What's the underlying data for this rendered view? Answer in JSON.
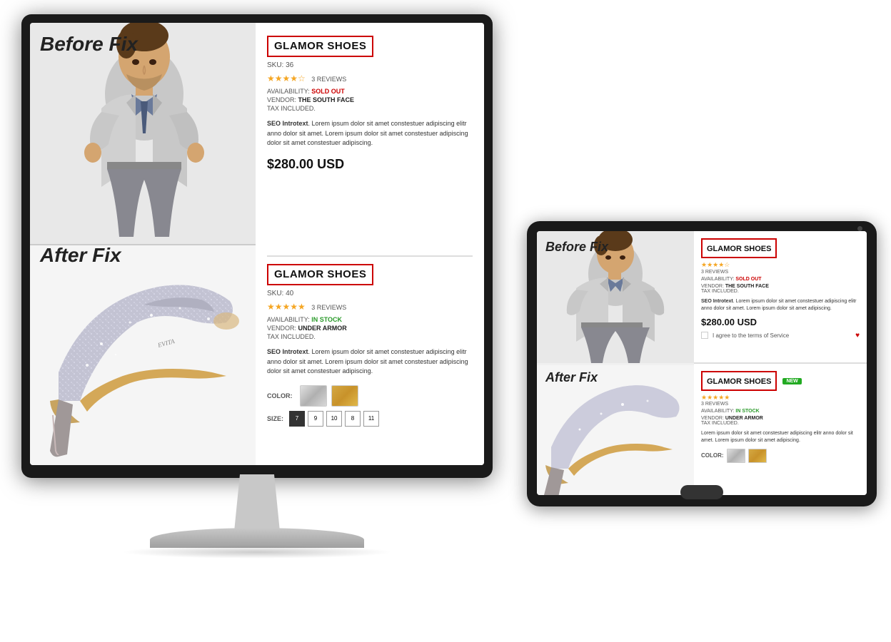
{
  "monitor": {
    "label_before": "Before Fix",
    "label_after": "After Fix",
    "product_before": {
      "title": "GLAMOR SHOES",
      "sku": "SKU: 36",
      "stars": 4,
      "max_stars": 5,
      "reviews": "3 REVIEWS",
      "availability_label": "AVAILABILITY:",
      "availability_value": "SOLD OUT",
      "vendor_label": "VENDOR:",
      "vendor_value": "THE SOUTH FACE",
      "tax": "TAX INCLUDED.",
      "seo_intro": "SEO Introtext",
      "seo_body": ". Lorem ipsum dolor sit amet constestuer adipiscing elitr anno dolor sit amet. Lorem ipsum dolor sit amet constestuer adipiscing dolor sit amet constestuer adipiscing.",
      "price": "$280.00 USD"
    },
    "product_after": {
      "title": "GLAMOR SHOES",
      "sku": "SKU: 40",
      "stars": 5,
      "max_stars": 5,
      "reviews": "3 REVIEWS",
      "availability_label": "AVAILABILITY:",
      "availability_value": "IN STOCK",
      "vendor_label": "VENDOR:",
      "vendor_value": "UNDER ARMOR",
      "tax": "TAX INCLUDED.",
      "seo_intro": "SEO Introtext",
      "seo_body": ". Lorem ipsum dolor sit amet constestuer adipiscing elitr anno dolor sit amet. Lorem ipsum dolor sit amet constestuer adipiscing dolor sit amet constestuer adipiscing.",
      "color_label": "COLOR:",
      "size_label": "SIZE:",
      "sizes": [
        "7",
        "9",
        "10",
        "8",
        "11"
      ]
    }
  },
  "tablet": {
    "label_before": "Before Fix",
    "label_after": "After Fix",
    "product_before": {
      "title": "GLAMOR SHOES",
      "stars": 4,
      "reviews": "3 REVIEWS",
      "availability_value": "SOLD OUT",
      "vendor_value": "THE SOUTH FACE",
      "tax": "TAX INCLUDED.",
      "seo_intro": "SEO Introtext",
      "seo_body": ". Lorem ipsum dolor sit amet constestuer adipiscing elitr anno dolor sit amet. Lorem ipsum dolor sit amet adipiscing.",
      "price": "$280.00 USD",
      "terms": "I agree to the terms of Service"
    },
    "product_after": {
      "title": "GLAMOR SHOES",
      "new_badge": "NEW",
      "stars": 5,
      "reviews": "3 REVIEWS",
      "availability_value": "IN STOCK",
      "vendor_value": "UNDER ARMOR",
      "tax": "TAX INCLUDED.",
      "seo_body": "Lorem ipsum dolor sit amet constestuer adipiscing elitr anno dolor sit amet. Lorem ipsum dolor sit amet adipiscing.",
      "color_label": "COLOR:"
    }
  },
  "colors": {
    "red_border": "#cc0000",
    "star_gold": "#f5a623",
    "sold_out_red": "#cc0000",
    "in_stock_green": "#2a9a2a",
    "new_badge_green": "#22aa22"
  }
}
